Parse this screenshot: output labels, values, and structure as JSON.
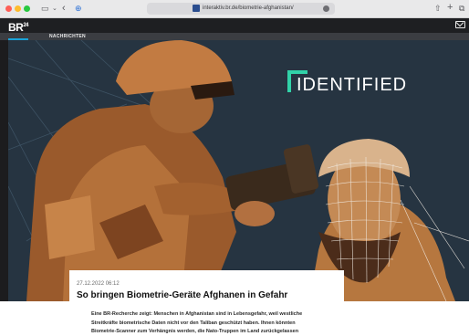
{
  "browser": {
    "url": "interaktiv.br.de/biometrie-afghanistan/",
    "icons": [
      "sidebar-icon",
      "chevron-down-icon",
      "back-icon",
      "shield-icon",
      "lock-icon",
      "share-icon",
      "new-tab-icon",
      "tabs-icon"
    ]
  },
  "site": {
    "logo": "BR",
    "logo_sup": "24",
    "nav_label": "NACHRICHTEN",
    "icons": [
      "mail-icon"
    ],
    "colors": {
      "accent": "#1aa3d8",
      "brand_teal": "#31d2a8"
    }
  },
  "hero": {
    "brand_word": "IDENTIFIED"
  },
  "article": {
    "date": "27.12.2022 06:12",
    "title": "So bringen Biometrie-Geräte Afghanen in Gefahr",
    "lead_lines": [
      "Eine BR-Recherche zeigt: Menschen in Afghanistan sind in Lebensgefahr, weil westliche",
      "Streitkräfte biometrische Daten nicht vor den Taliban geschützt haben. Ihnen könnten",
      "Biometrie-Scanner zum Verhängnis werden, die Nato-Truppen im Land zurückgelassen"
    ]
  }
}
